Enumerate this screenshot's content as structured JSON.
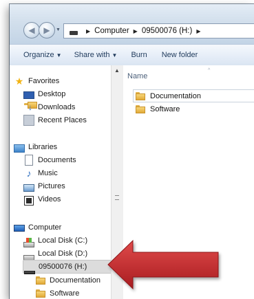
{
  "address_bar": {
    "segments": [
      "Computer",
      "09500076 (H:)"
    ]
  },
  "toolbar": {
    "organize": "Organize",
    "share_with": "Share with",
    "burn": "Burn",
    "new_folder": "New folder"
  },
  "nav_pane": {
    "favorites": {
      "label": "Favorites",
      "items": [
        "Desktop",
        "Downloads",
        "Recent Places"
      ]
    },
    "libraries": {
      "label": "Libraries",
      "items": [
        "Documents",
        "Music",
        "Pictures",
        "Videos"
      ]
    },
    "computer": {
      "label": "Computer",
      "items": [
        "Local Disk (C:)",
        "Local Disk (D:)",
        "09500076 (H:)"
      ],
      "selected": "09500076 (H:)",
      "subfolders": [
        "Documentation",
        "Software"
      ]
    }
  },
  "content": {
    "column_header": "Name",
    "files": [
      "Documentation",
      "Software"
    ]
  },
  "colors": {
    "arrow": "#c8262b",
    "selection": "#dcdcdc",
    "toolbar_text": "#1e395b"
  }
}
